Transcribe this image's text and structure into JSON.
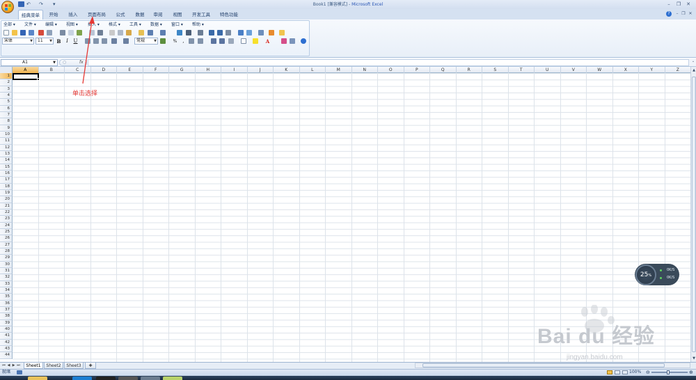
{
  "window": {
    "title": "Book1",
    "mode": "[兼容模式]",
    "app_name": "Microsoft Excel"
  },
  "quick_access": {
    "undo": "↶",
    "redo": "↷",
    "customize": "▾"
  },
  "window_controls": {
    "minimize": "–",
    "restore": "❐",
    "close": "✕"
  },
  "tabs": [
    "经典菜单",
    "开始",
    "插入",
    "页面布局",
    "公式",
    "数据",
    "审阅",
    "视图",
    "开发工具",
    "特色功能"
  ],
  "menu_items": [
    "全部 ▾",
    "文件 ▾",
    "编辑 ▾",
    "视图 ▾",
    "插入 ▾",
    "格式 ▾",
    "工具 ▾",
    "数据 ▾",
    "窗口 ▾",
    "帮助 ▾"
  ],
  "toolbar": {
    "font_name": "宋体",
    "font_size": "11",
    "number_format": "常规",
    "bold": "B",
    "italic": "I",
    "underline": "U",
    "percent": "%",
    "comma": ",",
    "font_color": "A"
  },
  "formula_bar": {
    "name_box": "A1",
    "fx": "fx",
    "formula": ""
  },
  "columns": [
    "A",
    "B",
    "C",
    "D",
    "E",
    "F",
    "G",
    "H",
    "I",
    "J",
    "K",
    "L",
    "M",
    "N",
    "O",
    "P",
    "Q",
    "R",
    "S",
    "T",
    "U",
    "V",
    "W",
    "X",
    "Y",
    "Z"
  ],
  "rows": [
    "1",
    "2",
    "3",
    "4",
    "5",
    "6",
    "7",
    "8",
    "9",
    "10",
    "11",
    "12",
    "13",
    "14",
    "15",
    "16",
    "17",
    "18",
    "19",
    "20",
    "21",
    "22",
    "23",
    "24",
    "25",
    "26",
    "27",
    "28",
    "29",
    "30",
    "31",
    "32",
    "33",
    "34",
    "35",
    "36",
    "37",
    "38",
    "39",
    "40",
    "41",
    "42",
    "43",
    "44"
  ],
  "selected_cell": "A1",
  "sheets": [
    "Sheet1",
    "Sheet2",
    "Sheet3"
  ],
  "status": {
    "ready": "就绪",
    "zoom": "100%"
  },
  "annotation": {
    "text": "单击选择",
    "color": "#e53935"
  },
  "speed_widget": {
    "percent": "25",
    "percent_sign": "%",
    "up": "0K/S",
    "down": "0K/S"
  },
  "watermark": {
    "brand": "Bai du 经验",
    "url": "jingyan.baidu.com"
  },
  "colors": {
    "accent_selected": "#f1b44f",
    "ribbon_bg": "#e8eff8",
    "annotation": "#e53935"
  }
}
